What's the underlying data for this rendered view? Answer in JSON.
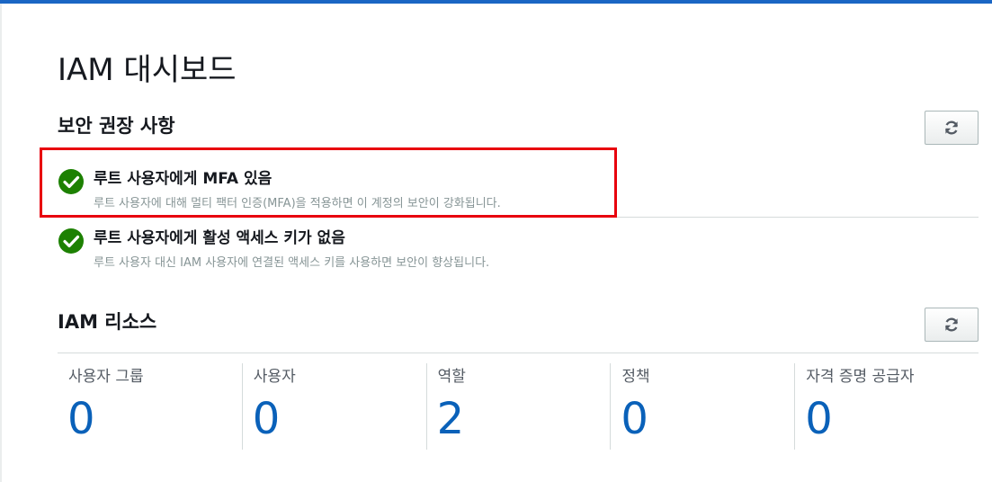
{
  "page": {
    "title": "IAM 대시보드"
  },
  "colors": {
    "accent": "#1a66c4",
    "link": "#0a61b9",
    "success": "#1d8102",
    "highlight": "#e8000d"
  },
  "recommendations": {
    "heading": "보안 권장 사항",
    "refresh_icon": "refresh-icon",
    "items": [
      {
        "title": "루트 사용자에게 MFA 있음",
        "description": "루트 사용자에 대해 멀티 팩터 인증(MFA)을 적용하면 이 계정의 보안이 강화됩니다.",
        "status_icon": "check-circle-icon"
      },
      {
        "title": "루트 사용자에게 활성 액세스 키가 없음",
        "description": "루트 사용자 대신 IAM 사용자에 연결된 액세스 키를 사용하면 보안이 향상됩니다.",
        "status_icon": "check-circle-icon"
      }
    ]
  },
  "resources": {
    "heading": "IAM 리소스",
    "refresh_icon": "refresh-icon",
    "items": [
      {
        "label": "사용자 그룹",
        "count": "0"
      },
      {
        "label": "사용자",
        "count": "0"
      },
      {
        "label": "역할",
        "count": "2"
      },
      {
        "label": "정책",
        "count": "0"
      },
      {
        "label": "자격 증명 공급자",
        "count": "0"
      }
    ]
  }
}
